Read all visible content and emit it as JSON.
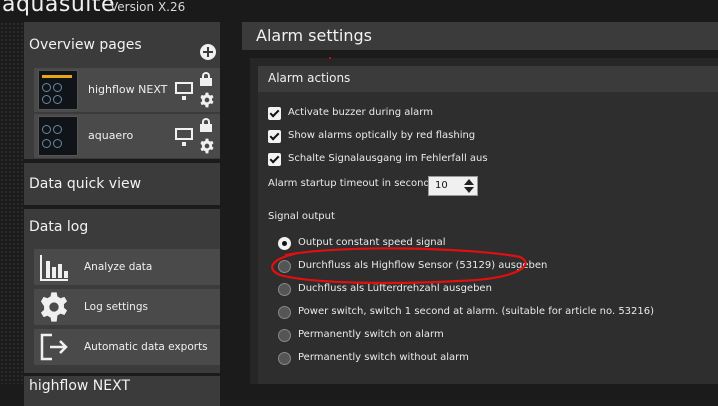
{
  "app": {
    "brand": "aquasuite",
    "version": "Version X.26"
  },
  "sidebar": {
    "overview": {
      "title": "Overview pages",
      "add_icon": "plus-circle-icon",
      "devices": [
        {
          "label": "highflow NEXT"
        },
        {
          "label": "aquaero"
        }
      ]
    },
    "quick_view": {
      "title": "Data quick view"
    },
    "data_log": {
      "title": "Data log",
      "items": [
        {
          "label": "Analyze data",
          "icon": "bar-chart-icon"
        },
        {
          "label": "Log settings",
          "icon": "gear-icon"
        },
        {
          "label": "Automatic data exports",
          "icon": "export-icon"
        }
      ]
    },
    "next_panel": {
      "title": "highflow NEXT"
    }
  },
  "main": {
    "title": "Alarm settings",
    "actions": {
      "header": "Alarm actions",
      "checkboxes": [
        {
          "label": "Activate buzzer during alarm",
          "checked": true
        },
        {
          "label": "Show alarms optically by red flashing",
          "checked": true
        },
        {
          "label": "Schalte Signalausgang im Fehlerfall aus",
          "checked": true
        }
      ],
      "timeout_label": "Alarm startup timeout in seconds.",
      "timeout_value": "10"
    },
    "signal_output": {
      "label": "Signal output",
      "options": [
        {
          "label": "Output constant speed signal",
          "selected": true
        },
        {
          "label": "Durchfluss als Highflow Sensor (53129) ausgeben",
          "selected": false
        },
        {
          "label": "Duchfluss als Lüfterdrehzahl ausgeben",
          "selected": false
        },
        {
          "label": "Power switch, switch 1 second at alarm. (suitable for article no. 53216)",
          "selected": false
        },
        {
          "label": "Permanently switch on alarm",
          "selected": false
        },
        {
          "label": "Permanently switch without alarm",
          "selected": false
        }
      ]
    }
  },
  "colors": {
    "annotation": "#e01010",
    "accent_bar": "#e6a817"
  }
}
